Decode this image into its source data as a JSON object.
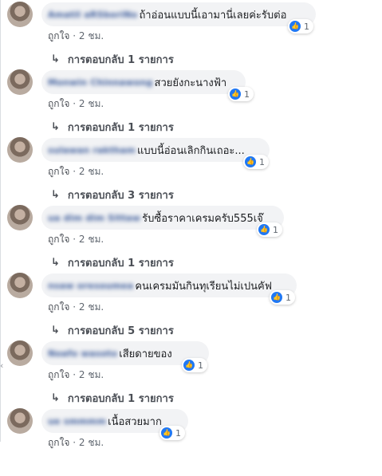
{
  "edge_glyph": "‹",
  "comments": [
    {
      "author": "Amatil aRSboriNo",
      "text": "ถ้าอ่อนแบบนี้เอามานี่เลยค่ะรับต่อ",
      "reaction_count": "1",
      "like_label": "ถูกใจ",
      "time": "2 ชม.",
      "replies_label": "การตอบกลับ 1 รายการ"
    },
    {
      "author": "Monwin Chinnawong",
      "text": "สวยยังกะนางฟ้า",
      "reaction_count": "1",
      "like_label": "ถูกใจ",
      "time": "2 ชม.",
      "replies_label": "การตอบกลับ 1 รายการ"
    },
    {
      "author": "sulawan raktham",
      "text": "แบบนี้อ่อนเลิกกินเถอะ...",
      "reaction_count": "1",
      "like_label": "ถูกใจ",
      "time": "2 ชม.",
      "replies_label": "การตอบกลับ 3 รายการ"
    },
    {
      "author": "ua dim dim Sittaw",
      "text": "รับซื้อราคาเครมครับ555เจ๊",
      "reaction_count": "1",
      "like_label": "ถูกใจ",
      "time": "2 ชม.",
      "replies_label": "การตอบกลับ 1 รายการ"
    },
    {
      "author": "nsaw oresoumea",
      "text": "คนเครมมันกินทุเรียนไม่เปนคัฟ",
      "reaction_count": "1",
      "like_label": "ถูกใจ",
      "time": "2 ชม.",
      "replies_label": "การตอบกลับ 5 รายการ"
    },
    {
      "author": "Noafo wasoto",
      "text": "เสียดายของ",
      "reaction_count": "1",
      "like_label": "ถูกใจ",
      "time": "2 ชม.",
      "replies_label": "การตอบกลับ 1 รายการ"
    },
    {
      "author": "ue smmmm",
      "text": "เนื้อสวยมาก",
      "reaction_count": "1",
      "like_label": "ถูกใจ",
      "time": "2 ชม.",
      "replies_label": ""
    }
  ]
}
